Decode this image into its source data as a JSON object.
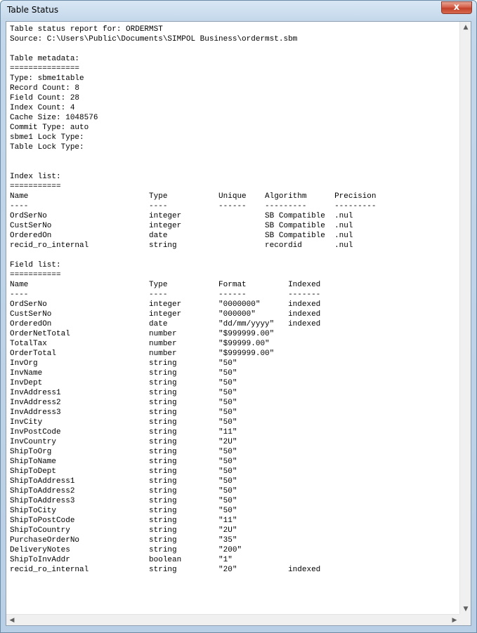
{
  "window": {
    "title": "Table Status",
    "close_glyph": "x"
  },
  "report": {
    "lines": [
      "Table status report for: ORDERMST",
      "Source: C:\\Users\\Public\\Documents\\SIMPOL Business\\ordermst.sbm",
      "",
      "Table metadata:",
      "===============",
      "Type: sbme1table",
      "Record Count: 8",
      "Field Count: 28",
      "Index Count: 4",
      "Cache Size: 1048576",
      "Commit Type: auto",
      "sbme1 Lock Type:",
      "Table Lock Type:",
      "",
      "",
      "Index list:",
      "===========",
      "Name                          Type           Unique    Algorithm      Precision",
      "----                          ----           ------    ---------      ---------",
      "OrdSerNo                      integer                  SB Compatible  .nul",
      "CustSerNo                     integer                  SB Compatible  .nul",
      "OrderedOn                     date                     SB Compatible  .nul",
      "recid_ro_internal             string                   recordid       .nul",
      "",
      "Field list:",
      "===========",
      "Name                          Type           Format         Indexed",
      "----                          ----           ------         -------",
      "OrdSerNo                      integer        \"0000000\"      indexed",
      "CustSerNo                     integer        \"000000\"       indexed",
      "OrderedOn                     date           \"dd/mm/yyyy\"   indexed",
      "OrderNetTotal                 number         \"$999999.00\"",
      "TotalTax                      number         \"$99999.00\"",
      "OrderTotal                    number         \"$999999.00\"",
      "InvOrg                        string         \"50\"",
      "InvName                       string         \"50\"",
      "InvDept                       string         \"50\"",
      "InvAddress1                   string         \"50\"",
      "InvAddress2                   string         \"50\"",
      "InvAddress3                   string         \"50\"",
      "InvCity                       string         \"50\"",
      "InvPostCode                   string         \"11\"",
      "InvCountry                    string         \"2U\"",
      "ShipToOrg                     string         \"50\"",
      "ShipToName                    string         \"50\"",
      "ShipToDept                    string         \"50\"",
      "ShipToAddress1                string         \"50\"",
      "ShipToAddress2                string         \"50\"",
      "ShipToAddress3                string         \"50\"",
      "ShipToCity                    string         \"50\"",
      "ShipToPostCode                string         \"11\"",
      "ShipToCountry                 string         \"2U\"",
      "PurchaseOrderNo               string         \"35\"",
      "DeliveryNotes                 string         \"200\"",
      "ShipToInvAddr                 boolean        \"1\"",
      "recid_ro_internal             string         \"20\"           indexed"
    ]
  },
  "scrollbars": {
    "up_arrow": "▲",
    "down_arrow": "▼",
    "left_arrow": "◀",
    "right_arrow": "▶"
  }
}
